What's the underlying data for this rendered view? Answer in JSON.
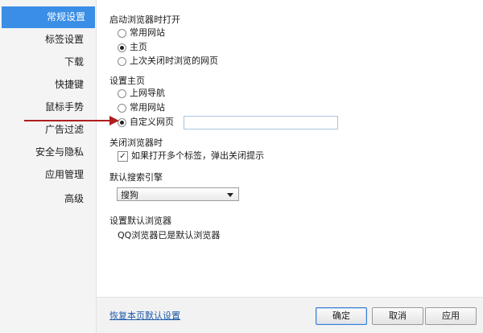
{
  "sidebar": {
    "items": [
      {
        "label": "常规设置",
        "active": true
      },
      {
        "label": "标签设置"
      },
      {
        "label": "下载"
      },
      {
        "label": "快捷键"
      },
      {
        "label": "鼠标手势"
      },
      {
        "label": "广告过滤"
      },
      {
        "label": "安全与隐私"
      },
      {
        "label": "应用管理"
      },
      {
        "label": "高级"
      }
    ]
  },
  "startup": {
    "title": "启动浏览器时打开",
    "options": [
      "常用网站",
      "主页",
      "上次关闭时浏览的网页"
    ],
    "selected": "主页"
  },
  "homepage": {
    "title": "设置主页",
    "options": [
      "上网导航",
      "常用网站",
      "自定义网页"
    ],
    "selected": "自定义网页",
    "custom_url_value": ""
  },
  "close_browser": {
    "title": "关闭浏览器时",
    "checkbox_label": "如果打开多个标签，弹出关闭提示",
    "checked": true
  },
  "search": {
    "title": "默认搜索引擎",
    "selected": "搜狗"
  },
  "default_browser": {
    "title": "设置默认浏览器",
    "status": "QQ浏览器已是默认浏览器"
  },
  "footer": {
    "restore_link": "恢复本页默认设置",
    "ok_label": "确定",
    "cancel_label": "取消",
    "apply_label": "应用"
  },
  "colors": {
    "active_sidebar": "#3a8ee6",
    "annotation_arrow": "#b01e1e",
    "link": "#1d5aa8"
  }
}
